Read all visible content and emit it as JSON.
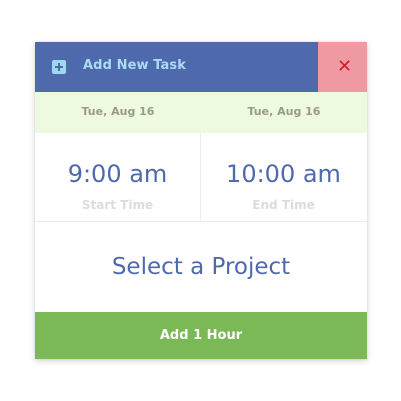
{
  "header": {
    "title": "Add New Task",
    "icon": "plus-square-icon",
    "close_icon": "close-icon",
    "close_symbol": "✕"
  },
  "dates": {
    "start": "Tue, Aug 16",
    "end": "Tue, Aug 16"
  },
  "times": {
    "start_value": "9:00 am",
    "start_label": "Start Time",
    "end_value": "10:00 am",
    "end_label": "End Time"
  },
  "project": {
    "placeholder": "Select a Project"
  },
  "action": {
    "add_hour_label": "Add 1 Hour"
  },
  "colors": {
    "header_bg": "#4f6aac",
    "header_text": "#a9dcf2",
    "close_bg": "#ef9aa3",
    "close_icon": "#d81c2c",
    "date_bg": "#edfae0",
    "primary_text": "#4f6aac",
    "action_bg": "#7bb956"
  }
}
